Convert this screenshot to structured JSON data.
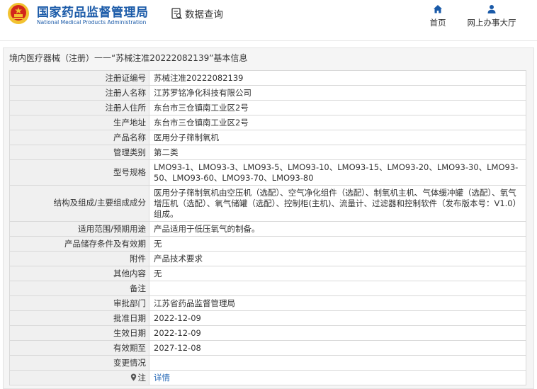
{
  "header": {
    "brand_cn": "国家药品监督管理局",
    "brand_en": "National Medical Products Administration",
    "data_query_label": "数据查询",
    "nav": {
      "home_label": "首页",
      "hall_label": "网上办事大厅"
    }
  },
  "breadcrumb": {
    "category": "境内医疗器械（注册）",
    "separator": "——",
    "record_title": "“苏械注准20222082139”基本信息"
  },
  "colors": {
    "brand_blue": "#1a5aa8",
    "link_blue": "#2b6cb8",
    "emblem_red": "#d2261c",
    "emblem_gold": "#f2c230"
  },
  "details": [
    {
      "label": "注册证编号",
      "value": "苏械注准20222082139"
    },
    {
      "label": "注册人名称",
      "value": "江苏罗铭净化科技有限公司"
    },
    {
      "label": "注册人住所",
      "value": "东台市三仓镇南工业区2号"
    },
    {
      "label": "生产地址",
      "value": "东台市三仓镇南工业区2号"
    },
    {
      "label": "产品名称",
      "value": "医用分子筛制氧机"
    },
    {
      "label": "管理类别",
      "value": "第二类"
    },
    {
      "label": "型号规格",
      "value": "LMO93-1、LMO93-3、LMO93-5、LMO93-10、LMO93-15、LMO93-20、LMO93-30、LMO93-50、LMO93-60、LMO93-70、LMO93-80"
    },
    {
      "label": "结构及组成/主要组成成分",
      "value": "医用分子筛制氧机由空压机（选配）、空气净化组件（选配）、制氧机主机、气体缓冲罐（选配）、氧气增压机（选配）、氧气储罐（选配）、控制柜(主机)、流量计、过滤器和控制软件（发布版本号：V1.0）组成。"
    },
    {
      "label": "适用范围/预期用途",
      "value": "产品适用于低压氧气的制备。"
    },
    {
      "label": "产品储存条件及有效期",
      "value": "无"
    },
    {
      "label": "附件",
      "value": "产品技术要求"
    },
    {
      "label": "其他内容",
      "value": "无"
    },
    {
      "label": "备注",
      "value": ""
    },
    {
      "label": "审批部门",
      "value": "江苏省药品监督管理局"
    },
    {
      "label": "批准日期",
      "value": "2022-12-09"
    },
    {
      "label": "生效日期",
      "value": "2022-12-09"
    },
    {
      "label": "有效期至",
      "value": "2027-12-08"
    },
    {
      "label": "变更情况",
      "value": ""
    }
  ],
  "note_row": {
    "label": "注",
    "link_text": "详情"
  }
}
